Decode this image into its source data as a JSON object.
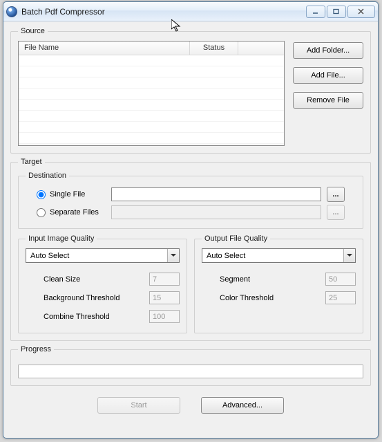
{
  "window": {
    "title": "Batch Pdf Compressor"
  },
  "source": {
    "legend": "Source",
    "columns": {
      "filename": "File Name",
      "status": "Status"
    },
    "buttons": {
      "add_folder": "Add Folder...",
      "add_file": "Add File...",
      "remove_file": "Remove File"
    }
  },
  "target": {
    "legend": "Target",
    "destination": {
      "legend": "Destination",
      "single_label": "Single File",
      "single_value": "",
      "separate_label": "Separate Files",
      "separate_value": "",
      "selected": "single",
      "browse_label": "..."
    },
    "input_quality": {
      "legend": "Input Image Quality",
      "select_value": "Auto Select",
      "clean_size": {
        "label": "Clean Size",
        "value": "7"
      },
      "background_threshold": {
        "label": "Background Threshold",
        "value": "15"
      },
      "combine_threshold": {
        "label": "Combine Threshold",
        "value": "100"
      }
    },
    "output_quality": {
      "legend": "Output File Quality",
      "select_value": "Auto Select",
      "segment": {
        "label": "Segment",
        "value": "50"
      },
      "color_threshold": {
        "label": "Color Threshold",
        "value": "25"
      }
    }
  },
  "progress": {
    "legend": "Progress"
  },
  "footer": {
    "start": "Start",
    "advanced": "Advanced..."
  }
}
